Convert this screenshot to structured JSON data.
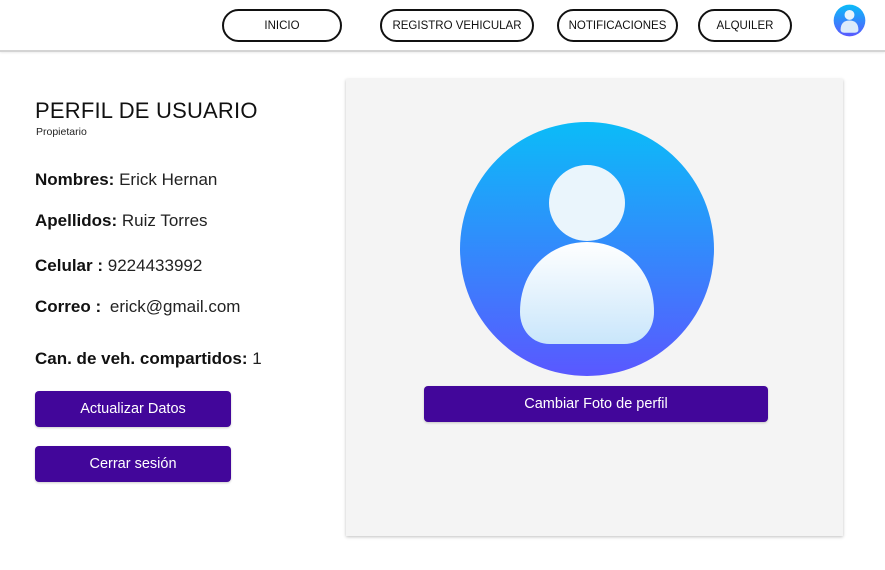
{
  "nav": {
    "inicio": "INICIO",
    "registro": "REGISTRO VEHICULAR",
    "notificaciones": "NOTIFICACIONES",
    "alquiler": "ALQUILER"
  },
  "icons": {
    "account": "user-avatar-icon",
    "profile_photo": "profile-photo-icon"
  },
  "profile": {
    "title": "PERFIL DE USUARIO",
    "role": "Propietario",
    "fields": {
      "nombres": {
        "label": "Nombres:",
        "value": "Erick Hernan"
      },
      "apellidos": {
        "label": "Apellidos:",
        "value": "Ruiz Torres"
      },
      "celular": {
        "label": "Celular :",
        "value": "9224433992"
      },
      "correo": {
        "label": "Correo :",
        "value": "erick@gmail.com"
      },
      "vehiculos": {
        "label": "Can. de veh. compartidos:",
        "value": "1"
      }
    }
  },
  "actions": {
    "update": "Actualizar Datos",
    "logout": "Cerrar sesión",
    "change_photo": "Cambiar Foto de perfil"
  },
  "colors": {
    "button": "#42069a",
    "avatar_top": "#0bbcf8",
    "avatar_bottom": "#5a58ff",
    "panel": "#f4f4f4"
  }
}
